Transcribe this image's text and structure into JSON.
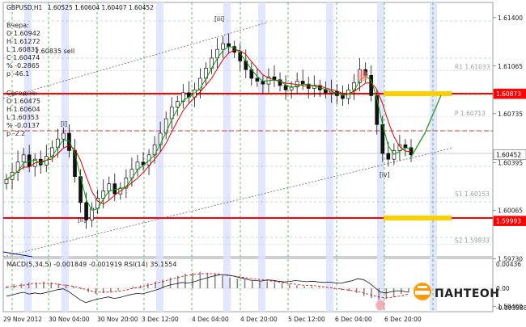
{
  "chart_data": {
    "type": "candlestick",
    "header": {
      "symbol": "GBPUSD,H1",
      "ohlc": "1.60525 1.60604 1.60407 1.60452"
    },
    "info_yesterday": [
      "Вчера:",
      "O 1.60942",
      "H 1.61272",
      "L 1.60835",
      "C 1.60474",
      "% -0.2865",
      "p -46.1"
    ],
    "info_today": [
      "Сегодня:",
      "O 1.60475",
      "H 1.60604",
      "L 1.60353",
      "% -0.0137",
      "p -2.2"
    ],
    "sell_label": "1.60835 sell",
    "x_ticks": [
      "29 Nov 2012",
      "30 Nov 04:00",
      "30 Nov 20:00",
      "3 Dec 12:00",
      "4 Dec 04:00",
      "4 Dec 20:00",
      "5 Dec 12:00",
      "6 Dec 04:00",
      "6 Dec 20:00"
    ],
    "y_ticks": [
      "1.61400",
      "1.61065",
      "1.60735",
      "1.60395",
      "1.60065",
      "1.59730",
      "1.59400"
    ],
    "y_range": [
      1.59745,
      1.61505
    ],
    "price_labels": [
      {
        "value": 1.60873,
        "text": "1.60873",
        "bg": "#ff0000",
        "fg": "#ffffff"
      },
      {
        "value": 1.60452,
        "text": "1.60452",
        "bg": "#ffffff",
        "fg": "#000000"
      },
      {
        "value": 1.59993,
        "text": "1.59993",
        "bg": "#ff0000",
        "fg": "#ffffff"
      }
    ],
    "levels": [
      {
        "name": "R1",
        "text": "R1 1.61033",
        "value": 1.61033
      },
      {
        "name": "P",
        "text": "P 1.60713",
        "value": 1.60713
      },
      {
        "name": "S1",
        "text": "S1 1.60153",
        "value": 1.60153
      },
      {
        "name": "S2",
        "text": "S2 1.59833",
        "value": 1.59833
      }
    ],
    "red_lines": [
      1.60873,
      1.59993
    ],
    "waves": [
      "[i]",
      "[ii]",
      "[iii]",
      "[iv]"
    ],
    "macd_header": "MACD(5,34,5) -0.001849 -0.001919  RSI(14) 35.1554",
    "macd_ticks": [
      "0.00436",
      "0.00",
      "-0.003588"
    ],
    "closes": [
      1.6028,
      1.6033,
      1.604,
      1.6045,
      1.6037,
      1.6042,
      1.6038,
      1.6044,
      1.605,
      1.6056,
      1.606,
      1.6048,
      1.603,
      1.6012,
      1.6,
      1.6008,
      1.6015,
      1.602,
      1.6025,
      1.6018,
      1.6022,
      1.6029,
      1.6035,
      1.604,
      1.6038,
      1.6045,
      1.6052,
      1.606,
      1.607,
      1.6078,
      1.6082,
      1.6088,
      1.6085,
      1.609,
      1.6098,
      1.6105,
      1.6112,
      1.6118,
      1.6122,
      1.612,
      1.6116,
      1.611,
      1.6104,
      1.6098,
      1.6096,
      1.6094,
      1.6099,
      1.6097,
      1.6093,
      1.609,
      1.6092,
      1.6096,
      1.6094,
      1.6091,
      1.6093,
      1.609,
      1.6088,
      1.6089,
      1.6086,
      1.6084,
      1.609,
      1.6095,
      1.6104,
      1.61,
      1.6086,
      1.6066,
      1.6046,
      1.6042,
      1.6048,
      1.6052,
      1.605,
      1.6045
    ],
    "macd_hist": [
      0.2,
      0.4,
      0.5,
      0.6,
      0.6,
      0.7,
      0.6,
      0.5,
      0.4,
      0.2,
      -0.1,
      -0.4,
      -0.6,
      -0.5,
      -0.4,
      -0.2,
      0,
      0.2,
      0.3,
      0.5,
      0.7,
      0.9,
      1.1,
      1.3,
      1.5,
      1.6,
      1.7,
      1.6,
      1.5,
      1.3,
      1.1,
      1.0,
      0.9,
      0.8,
      0.8,
      0.7,
      0.6,
      0.5,
      0.4,
      0.3,
      0.2,
      0.2,
      0.1,
      0,
      -0.1,
      -0.2,
      -0.3,
      -0.5,
      -0.8,
      -1.0,
      -1.2,
      -1.1,
      -0.9,
      -0.6,
      -0.4
    ],
    "macd_signal": [
      0.1,
      0.2,
      0.3,
      0.4,
      0.5,
      0.5,
      0.5,
      0.4,
      0.3,
      0.2,
      0,
      -0.2,
      -0.4,
      -0.4,
      -0.4,
      -0.3,
      -0.2,
      0,
      0.1,
      0.3,
      0.5,
      0.7,
      0.9,
      1.1,
      1.3,
      1.4,
      1.5,
      1.5,
      1.5,
      1.4,
      1.3,
      1.2,
      1.1,
      1.0,
      0.9,
      0.8,
      0.7,
      0.6,
      0.5,
      0.4,
      0.3,
      0.3,
      0.2,
      0.1,
      0,
      -0.1,
      -0.2,
      -0.3,
      -0.5,
      -0.7,
      -0.9,
      -1.0,
      -0.9,
      -0.8,
      -0.6
    ]
  },
  "logo": {
    "text": "ПАНТЕОН"
  }
}
